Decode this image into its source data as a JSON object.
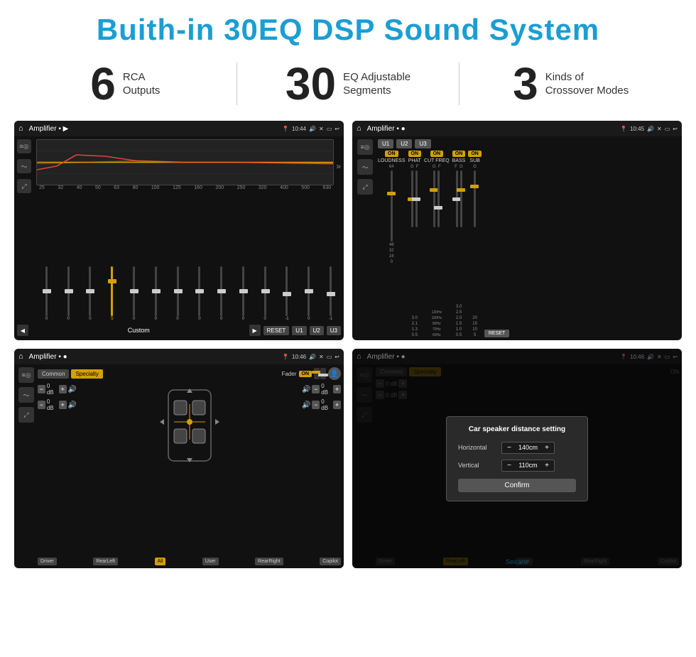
{
  "header": {
    "title": "Buith-in 30EQ DSP Sound System"
  },
  "stats": [
    {
      "number": "6",
      "text": "RCA\nOutputs"
    },
    {
      "number": "30",
      "text": "EQ Adjustable\nSegments"
    },
    {
      "number": "3",
      "text": "Kinds of\nCrossover Modes"
    }
  ],
  "screens": {
    "screen1": {
      "title": "Amplifier",
      "time": "10:44",
      "eq_bands": [
        "25",
        "32",
        "40",
        "50",
        "63",
        "80",
        "100",
        "125",
        "160",
        "200",
        "250",
        "320",
        "400",
        "500",
        "630"
      ],
      "eq_values": [
        "0",
        "0",
        "0",
        "5",
        "0",
        "0",
        "0",
        "0",
        "0",
        "0",
        "0",
        "-1",
        "0",
        "-1"
      ],
      "mode_label": "Custom",
      "buttons": [
        "RESET",
        "U1",
        "U2",
        "U3"
      ]
    },
    "screen2": {
      "title": "Amplifier",
      "time": "10:45",
      "presets": [
        "U1",
        "U2",
        "U3"
      ],
      "controls": [
        "LOUDNESS",
        "PHAT",
        "CUT FREQ",
        "BASS",
        "SUB"
      ],
      "reset_label": "RESET"
    },
    "screen3": {
      "title": "Amplifier",
      "time": "10:46",
      "tabs": [
        "Common",
        "Specialty"
      ],
      "fader_label": "Fader",
      "on_label": "ON",
      "btns": [
        "Driver",
        "RearLeft",
        "All",
        "User",
        "RearRight",
        "Copilot"
      ],
      "db_values": [
        "0 dB",
        "0 dB",
        "0 dB",
        "0 dB"
      ]
    },
    "screen4": {
      "title": "Amplifier",
      "time": "10:46",
      "dialog": {
        "title": "Car speaker distance setting",
        "horizontal_label": "Horizontal",
        "horizontal_value": "140cm",
        "vertical_label": "Vertical",
        "vertical_value": "110cm",
        "confirm_label": "Confirm"
      },
      "btns": [
        "Driver",
        "RearLeft",
        "All",
        "User",
        "RearRight",
        "Copilot"
      ]
    }
  },
  "watermark": "Seicane"
}
